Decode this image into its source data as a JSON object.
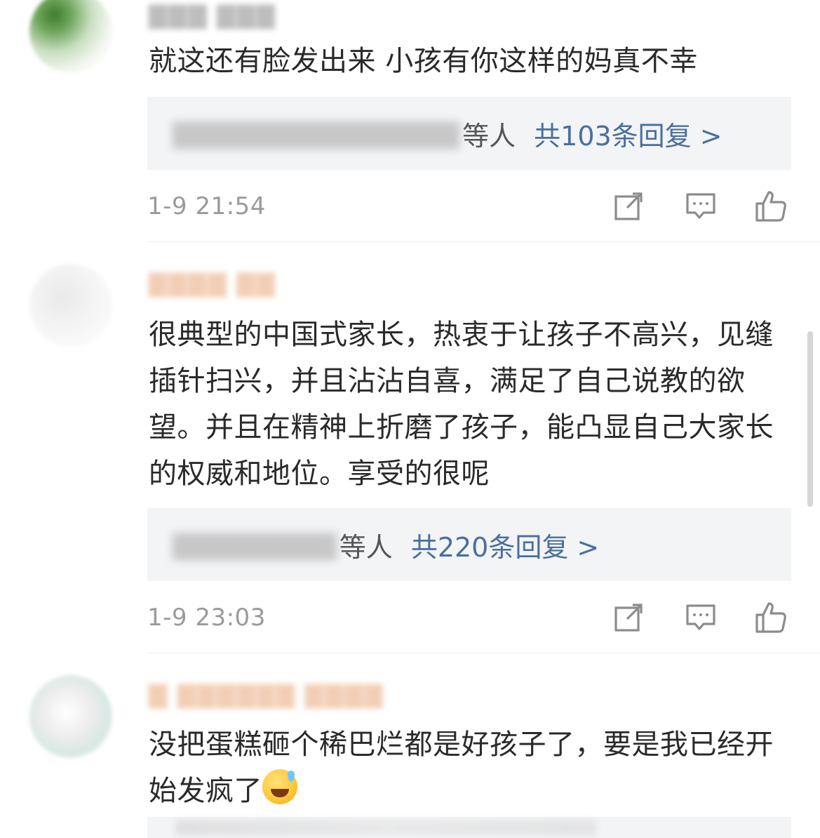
{
  "comments": [
    {
      "text": "就这还有脸发出来 小孩有你这样的妈真不幸",
      "reply_suffix": "等人",
      "reply_count": "共103条回复 >",
      "timestamp": "1-9 21:54"
    },
    {
      "text": "很典型的中国式家长，热衷于让孩子不高兴，见缝插针扫兴，并且沾沾自喜，满足了自己说教的欲望。并且在精神上折磨了孩子，能凸显自己大家长的权威和地位。享受的很呢",
      "reply_suffix": "等人",
      "reply_count": "共220条回复 >",
      "timestamp": "1-9 23:03"
    },
    {
      "text": "没把蛋糕砸个稀巴烂都是好孩子了，要是我已经开始发疯了"
    }
  ],
  "icons": {
    "share": "share-icon",
    "comment": "comment-icon",
    "like": "like-icon"
  },
  "colors": {
    "reply_link": "#4a6f9d",
    "timestamp": "#9a9a9a",
    "reply_bg": "#f3f4f6"
  }
}
